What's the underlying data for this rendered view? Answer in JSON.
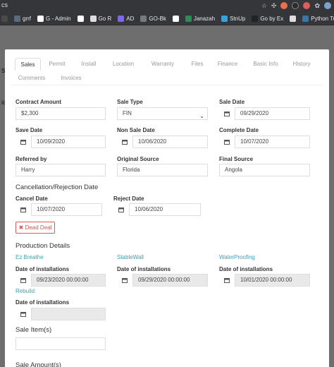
{
  "browser": {
    "tab_text": "cs",
    "bookmarks": [
      {
        "label": "",
        "color": "#4a4a4a"
      },
      {
        "label": "grrf",
        "color": "#5a6b7c"
      },
      {
        "label": "G - Admin",
        "color": "#ffffff"
      },
      {
        "label": "",
        "color": "#ffffff"
      },
      {
        "label": "Go R",
        "color": "#dddddd"
      },
      {
        "label": "AD",
        "color": "#7b68ee"
      },
      {
        "label": "GO-Bk",
        "color": "#7a7a7a"
      },
      {
        "label": "",
        "color": "#ffffff"
      },
      {
        "label": "Janazah",
        "color": "#2e8b57"
      },
      {
        "label": "StnUp",
        "color": "#3aa0d8"
      },
      {
        "label": "Go by Ex",
        "color": "#222222"
      },
      {
        "label": "",
        "color": "#dddddd"
      },
      {
        "label": "Python Tut",
        "color": "#3776ab"
      },
      {
        "label": "",
        "color": "#2aa198"
      }
    ]
  },
  "tabs": [
    "Sales",
    "Permit",
    "Install",
    "Location",
    "Warranty",
    "Files",
    "Finance",
    "Basic Info",
    "History",
    "Comments",
    "Invoices"
  ],
  "fields": {
    "contract_amount": {
      "label": "Contract Amount",
      "value": "$2,300"
    },
    "sale_type": {
      "label": "Sale Type",
      "value": "FIN"
    },
    "sale_date": {
      "label": "Sale Date",
      "value": "09/29/2020"
    },
    "save_date": {
      "label": "Save Date",
      "value": "10/09/2020"
    },
    "non_sale_date": {
      "label": "Non Sale Date",
      "value": "10/06/2020"
    },
    "complete_date": {
      "label": "Complete Date",
      "value": "10/07/2020"
    },
    "referred_by": {
      "label": "Referred by",
      "value": "Harry"
    },
    "original_source": {
      "label": "Original Source",
      "value": "Florida"
    },
    "final_source": {
      "label": "Final Source",
      "value": "Angola"
    }
  },
  "cancellation": {
    "title": "Cancellation/Rejection Date",
    "cancel_date": {
      "label": "Cancel Date",
      "value": "10/07/2020"
    },
    "reject_date": {
      "label": "Reject Date",
      "value": "10/06/2020"
    },
    "dead_deal_label": "Dead Deal"
  },
  "production": {
    "title": "Production Details",
    "items": [
      {
        "name": "Ez Breathe",
        "date_label": "Date of installations",
        "value": "09/23/2020 00:00:00"
      },
      {
        "name": "StableWall",
        "date_label": "Date of installations",
        "value": "09/29/2020 00:00:00"
      },
      {
        "name": "WaterProofing",
        "date_label": "Date of installations",
        "value": "10/01/2020 00:00:00"
      },
      {
        "name": "Rebuild",
        "date_label": "Date of installations",
        "value": ""
      }
    ]
  },
  "sale_items_title": "Sale Item(s)",
  "sale_amounts_title": "Sale Amount(s)"
}
